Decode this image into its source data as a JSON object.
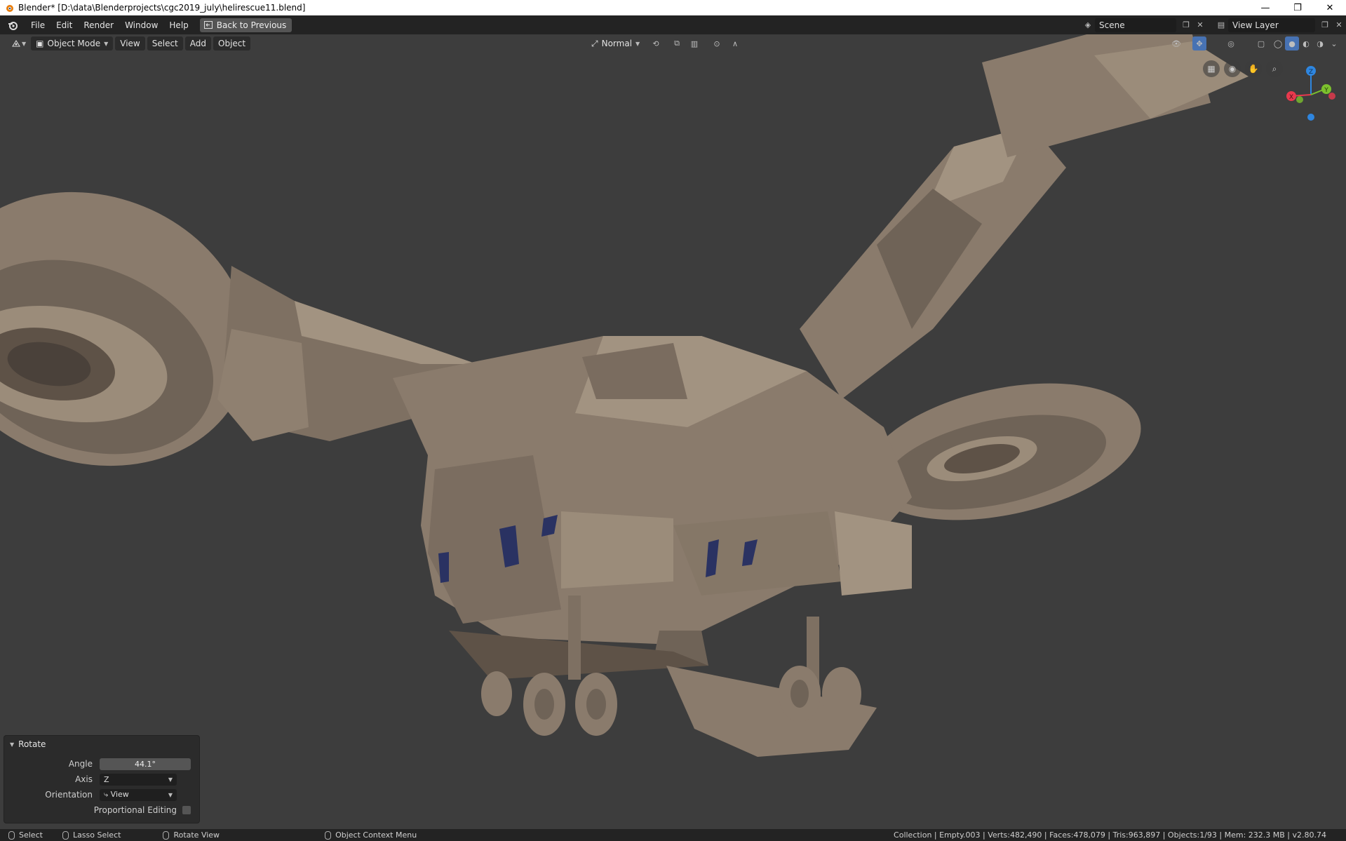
{
  "window": {
    "title": "Blender* [D:\\data\\Blenderprojects\\cgc2019_july\\helirescue11.blend]",
    "controls": [
      "—",
      "❐",
      "✕"
    ]
  },
  "topbar": {
    "menus": [
      "File",
      "Edit",
      "Render",
      "Window",
      "Help"
    ],
    "back_label": "Back to Previous",
    "scene_value": "Scene",
    "view_layer_value": "View Layer"
  },
  "viewport_header": {
    "mode_label": "Object Mode",
    "menus": [
      "View",
      "Select",
      "Add",
      "Object"
    ],
    "orientation_label": "Normal"
  },
  "gizmo": {
    "x_label": "X",
    "y_label": "Y",
    "z_label": "Z"
  },
  "operator_panel": {
    "title": "Rotate",
    "angle_label": "Angle",
    "angle_value": "44.1°",
    "axis_label": "Axis",
    "axis_value": "Z",
    "orientation_label": "Orientation",
    "orientation_value": "View",
    "proportional_label": "Proportional Editing",
    "proportional_checked": false
  },
  "statusbar": {
    "select": "Select",
    "lasso": "Lasso Select",
    "rotate": "Rotate View",
    "context_menu": "Object Context Menu",
    "stats": "Collection | Empty.003 | Verts:482,490 | Faces:478,079 | Tris:963,897 | Objects:1/93 | Mem: 232.3 MB | v2.80.74"
  },
  "colors": {
    "model": "#8a7b6c",
    "model_light": "#a29381",
    "model_dark": "#5e5247",
    "windows": "#2a3262",
    "viewport_bg": "#3d3d3d",
    "x_axis": "#e8394d",
    "y_axis": "#7cc12d",
    "z_axis": "#2e86e0"
  }
}
